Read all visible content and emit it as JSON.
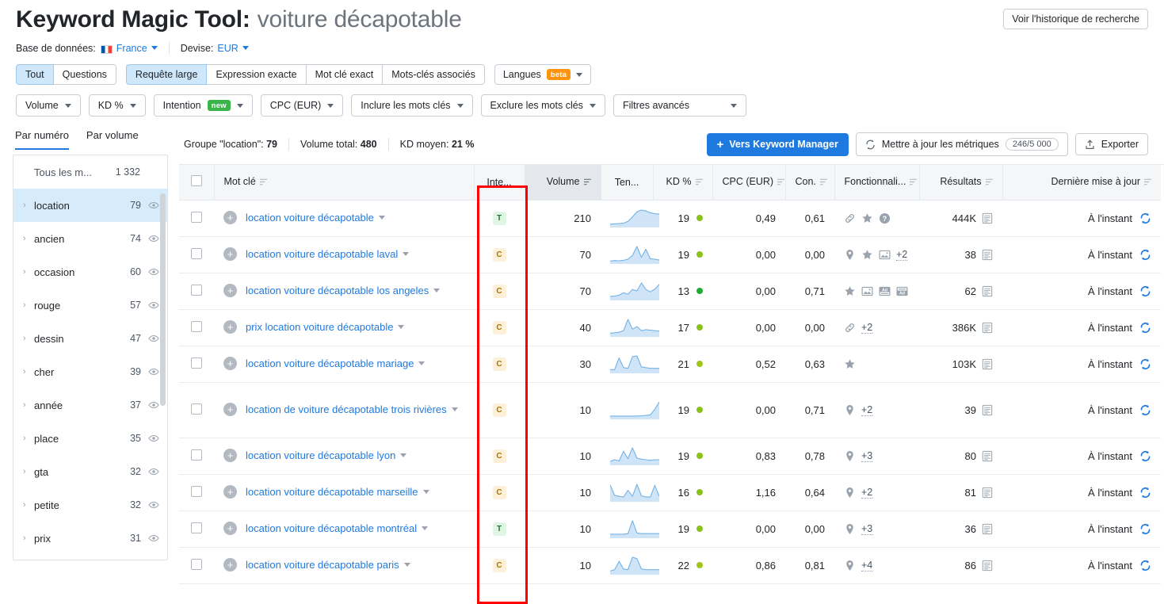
{
  "header": {
    "title_main": "Keyword Magic Tool:",
    "title_term": "voiture décapotable",
    "history_button": "Voir l'historique de recherche",
    "database_label": "Base de données:",
    "database_value": "France",
    "currency_label": "Devise:",
    "currency_value": "EUR"
  },
  "filters": {
    "match_tabs": [
      {
        "label": "Tout",
        "active": true
      },
      {
        "label": "Questions",
        "active": false
      }
    ],
    "type_tabs": [
      {
        "label": "Requête large",
        "active": true
      },
      {
        "label": "Expression exacte",
        "active": false
      },
      {
        "label": "Mot clé exact",
        "active": false
      },
      {
        "label": "Mots-clés associés",
        "active": false
      }
    ],
    "languages": {
      "label": "Langues",
      "badge": "beta"
    },
    "dropdowns": [
      {
        "label": "Volume",
        "badge": null
      },
      {
        "label": "KD %",
        "badge": null
      },
      {
        "label": "Intention",
        "badge": "new"
      },
      {
        "label": "CPC (EUR)",
        "badge": null
      },
      {
        "label": "Inclure les mots clés",
        "badge": null
      },
      {
        "label": "Exclure les mots clés",
        "badge": null
      },
      {
        "label": "Filtres avancés",
        "badge": null
      }
    ]
  },
  "sidebar": {
    "tabs": [
      {
        "label": "Par numéro",
        "active": true
      },
      {
        "label": "Par volume",
        "active": false
      }
    ],
    "all_label": "Tous les m...",
    "all_count": "1 332",
    "items": [
      {
        "label": "location",
        "count": "79",
        "selected": true
      },
      {
        "label": "ancien",
        "count": "74",
        "selected": false
      },
      {
        "label": "occasion",
        "count": "60",
        "selected": false
      },
      {
        "label": "rouge",
        "count": "57",
        "selected": false
      },
      {
        "label": "dessin",
        "count": "47",
        "selected": false
      },
      {
        "label": "cher",
        "count": "39",
        "selected": false
      },
      {
        "label": "année",
        "count": "37",
        "selected": false
      },
      {
        "label": "place",
        "count": "35",
        "selected": false
      },
      {
        "label": "gta",
        "count": "32",
        "selected": false
      },
      {
        "label": "petite",
        "count": "32",
        "selected": false
      },
      {
        "label": "prix",
        "count": "31",
        "selected": false
      }
    ]
  },
  "toolbar": {
    "group_label": "Groupe \"location\":",
    "group_value": "79",
    "volume_label": "Volume total:",
    "volume_value": "480",
    "kd_label": "KD moyen:",
    "kd_value": "21 %",
    "keyword_manager_button": "Vers Keyword Manager",
    "update_metrics_button": "Mettre à jour les métriques",
    "update_metrics_count": "246/5 000",
    "export_button": "Exporter"
  },
  "table": {
    "columns": [
      {
        "label": "Mot clé",
        "align": "lft",
        "sortable": true,
        "highlight": false
      },
      {
        "label": "Inte...",
        "align": "ctr",
        "sortable": false,
        "highlight": false
      },
      {
        "label": "Volume",
        "align": "rgt",
        "sortable": true,
        "highlight": true
      },
      {
        "label": "Ten...",
        "align": "ctr",
        "sortable": false,
        "highlight": false
      },
      {
        "label": "KD %",
        "align": "rgt",
        "sortable": true,
        "highlight": false
      },
      {
        "label": "CPC (EUR)",
        "align": "rgt",
        "sortable": true,
        "highlight": false
      },
      {
        "label": "Con.",
        "align": "rgt",
        "sortable": true,
        "highlight": false
      },
      {
        "label": "Fonctionnali...",
        "align": "lft",
        "sortable": true,
        "highlight": false
      },
      {
        "label": "Résultats",
        "align": "rgt",
        "sortable": true,
        "highlight": false
      },
      {
        "label": "Dernière mise à jour",
        "align": "rgt",
        "sortable": true,
        "highlight": false
      }
    ],
    "rows": [
      {
        "keyword": "location voiture décapotable",
        "intent": "T",
        "volume": "210",
        "trend": [
          8,
          9,
          10,
          12,
          20,
          40,
          62,
          70,
          66,
          58,
          54,
          52
        ],
        "kd": "19",
        "kd_color": "#8ac21c",
        "cpc": "0,49",
        "con": "0,61",
        "features": [
          "link-icon",
          "star-icon",
          "question-icon"
        ],
        "features_more": null,
        "results": "444K",
        "updated": "À l'instant"
      },
      {
        "keyword": "location voiture décapotable laval",
        "intent": "C",
        "volume": "70",
        "trend": [
          6,
          8,
          7,
          9,
          14,
          30,
          70,
          22,
          58,
          16,
          14,
          10
        ],
        "kd": "19",
        "kd_color": "#8ac21c",
        "cpc": "0,00",
        "con": "0,00",
        "features": [
          "map-pin-icon",
          "star-icon",
          "image-icon"
        ],
        "features_more": "+2",
        "results": "38",
        "updated": "À l'instant"
      },
      {
        "keyword": "location voiture décapotable los angeles",
        "intent": "C",
        "volume": "70",
        "trend": [
          10,
          12,
          16,
          26,
          20,
          40,
          34,
          68,
          40,
          30,
          42,
          62
        ],
        "kd": "13",
        "kd_color": "#1fab32",
        "cpc": "0,00",
        "con": "0,71",
        "features": [
          "star-icon",
          "image-icon",
          "ad-top-icon",
          "ad-bottom-icon"
        ],
        "features_more": null,
        "results": "62",
        "updated": "À l'instant"
      },
      {
        "keyword": "prix location voiture décapotable",
        "intent": "C",
        "volume": "40",
        "trend": [
          8,
          10,
          12,
          18,
          62,
          24,
          34,
          18,
          22,
          20,
          18,
          16
        ],
        "kd": "17",
        "kd_color": "#8ac21c",
        "cpc": "0,00",
        "con": "0,00",
        "features": [
          "link-icon"
        ],
        "features_more": "+2",
        "results": "386K",
        "updated": "À l'instant"
      },
      {
        "keyword": "location voiture décapotable mariage",
        "intent": "C",
        "volume": "30",
        "trend": [
          6,
          6,
          40,
          12,
          10,
          44,
          46,
          14,
          12,
          10,
          10,
          10
        ],
        "kd": "21",
        "kd_color": "#a2c51a",
        "cpc": "0,52",
        "con": "0,63",
        "features": [
          "star-icon"
        ],
        "features_more": null,
        "results": "103K",
        "updated": "À l'instant"
      },
      {
        "keyword": "location de voiture décapotable trois rivières",
        "intent": "C",
        "volume": "10",
        "trend": [
          6,
          6,
          6,
          6,
          6,
          6,
          6,
          7,
          8,
          10,
          30,
          56
        ],
        "kd": "19",
        "kd_color": "#8ac21c",
        "cpc": "0,00",
        "con": "0,71",
        "features": [
          "map-pin-icon"
        ],
        "features_more": "+2",
        "results": "39",
        "updated": "À l'instant"
      },
      {
        "keyword": "location voiture décapotable lyon",
        "intent": "C",
        "volume": "10",
        "trend": [
          8,
          14,
          10,
          44,
          18,
          56,
          20,
          16,
          14,
          12,
          14,
          14
        ],
        "kd": "19",
        "kd_color": "#8ac21c",
        "cpc": "0,83",
        "con": "0,78",
        "features": [
          "map-pin-icon"
        ],
        "features_more": "+3",
        "results": "80",
        "updated": "À l'instant"
      },
      {
        "keyword": "location voiture décapotable marseille",
        "intent": "C",
        "volume": "10",
        "trend": [
          56,
          18,
          14,
          12,
          36,
          14,
          58,
          16,
          12,
          12,
          54,
          14
        ],
        "kd": "16",
        "kd_color": "#8ac21c",
        "cpc": "1,16",
        "con": "0,64",
        "features": [
          "map-pin-icon"
        ],
        "features_more": "+2",
        "results": "81",
        "updated": "À l'instant"
      },
      {
        "keyword": "location voiture décapotable montréal",
        "intent": "T",
        "volume": "10",
        "trend": [
          8,
          8,
          8,
          8,
          10,
          52,
          12,
          10,
          10,
          10,
          10,
          10
        ],
        "kd": "19",
        "kd_color": "#8ac21c",
        "cpc": "0,00",
        "con": "0,00",
        "features": [
          "map-pin-icon"
        ],
        "features_more": "+3",
        "results": "36",
        "updated": "À l'instant"
      },
      {
        "keyword": "location voiture décapotable paris",
        "intent": "C",
        "volume": "10",
        "trend": [
          6,
          10,
          34,
          12,
          10,
          46,
          42,
          12,
          10,
          10,
          10,
          10
        ],
        "kd": "22",
        "kd_color": "#a2c51a",
        "cpc": "0,86",
        "con": "0,81",
        "features": [
          "map-pin-icon"
        ],
        "features_more": "+4",
        "results": "86",
        "updated": "À l'instant"
      }
    ]
  },
  "annotation": {
    "color": "#ff0000",
    "target_column": "Inte..."
  }
}
